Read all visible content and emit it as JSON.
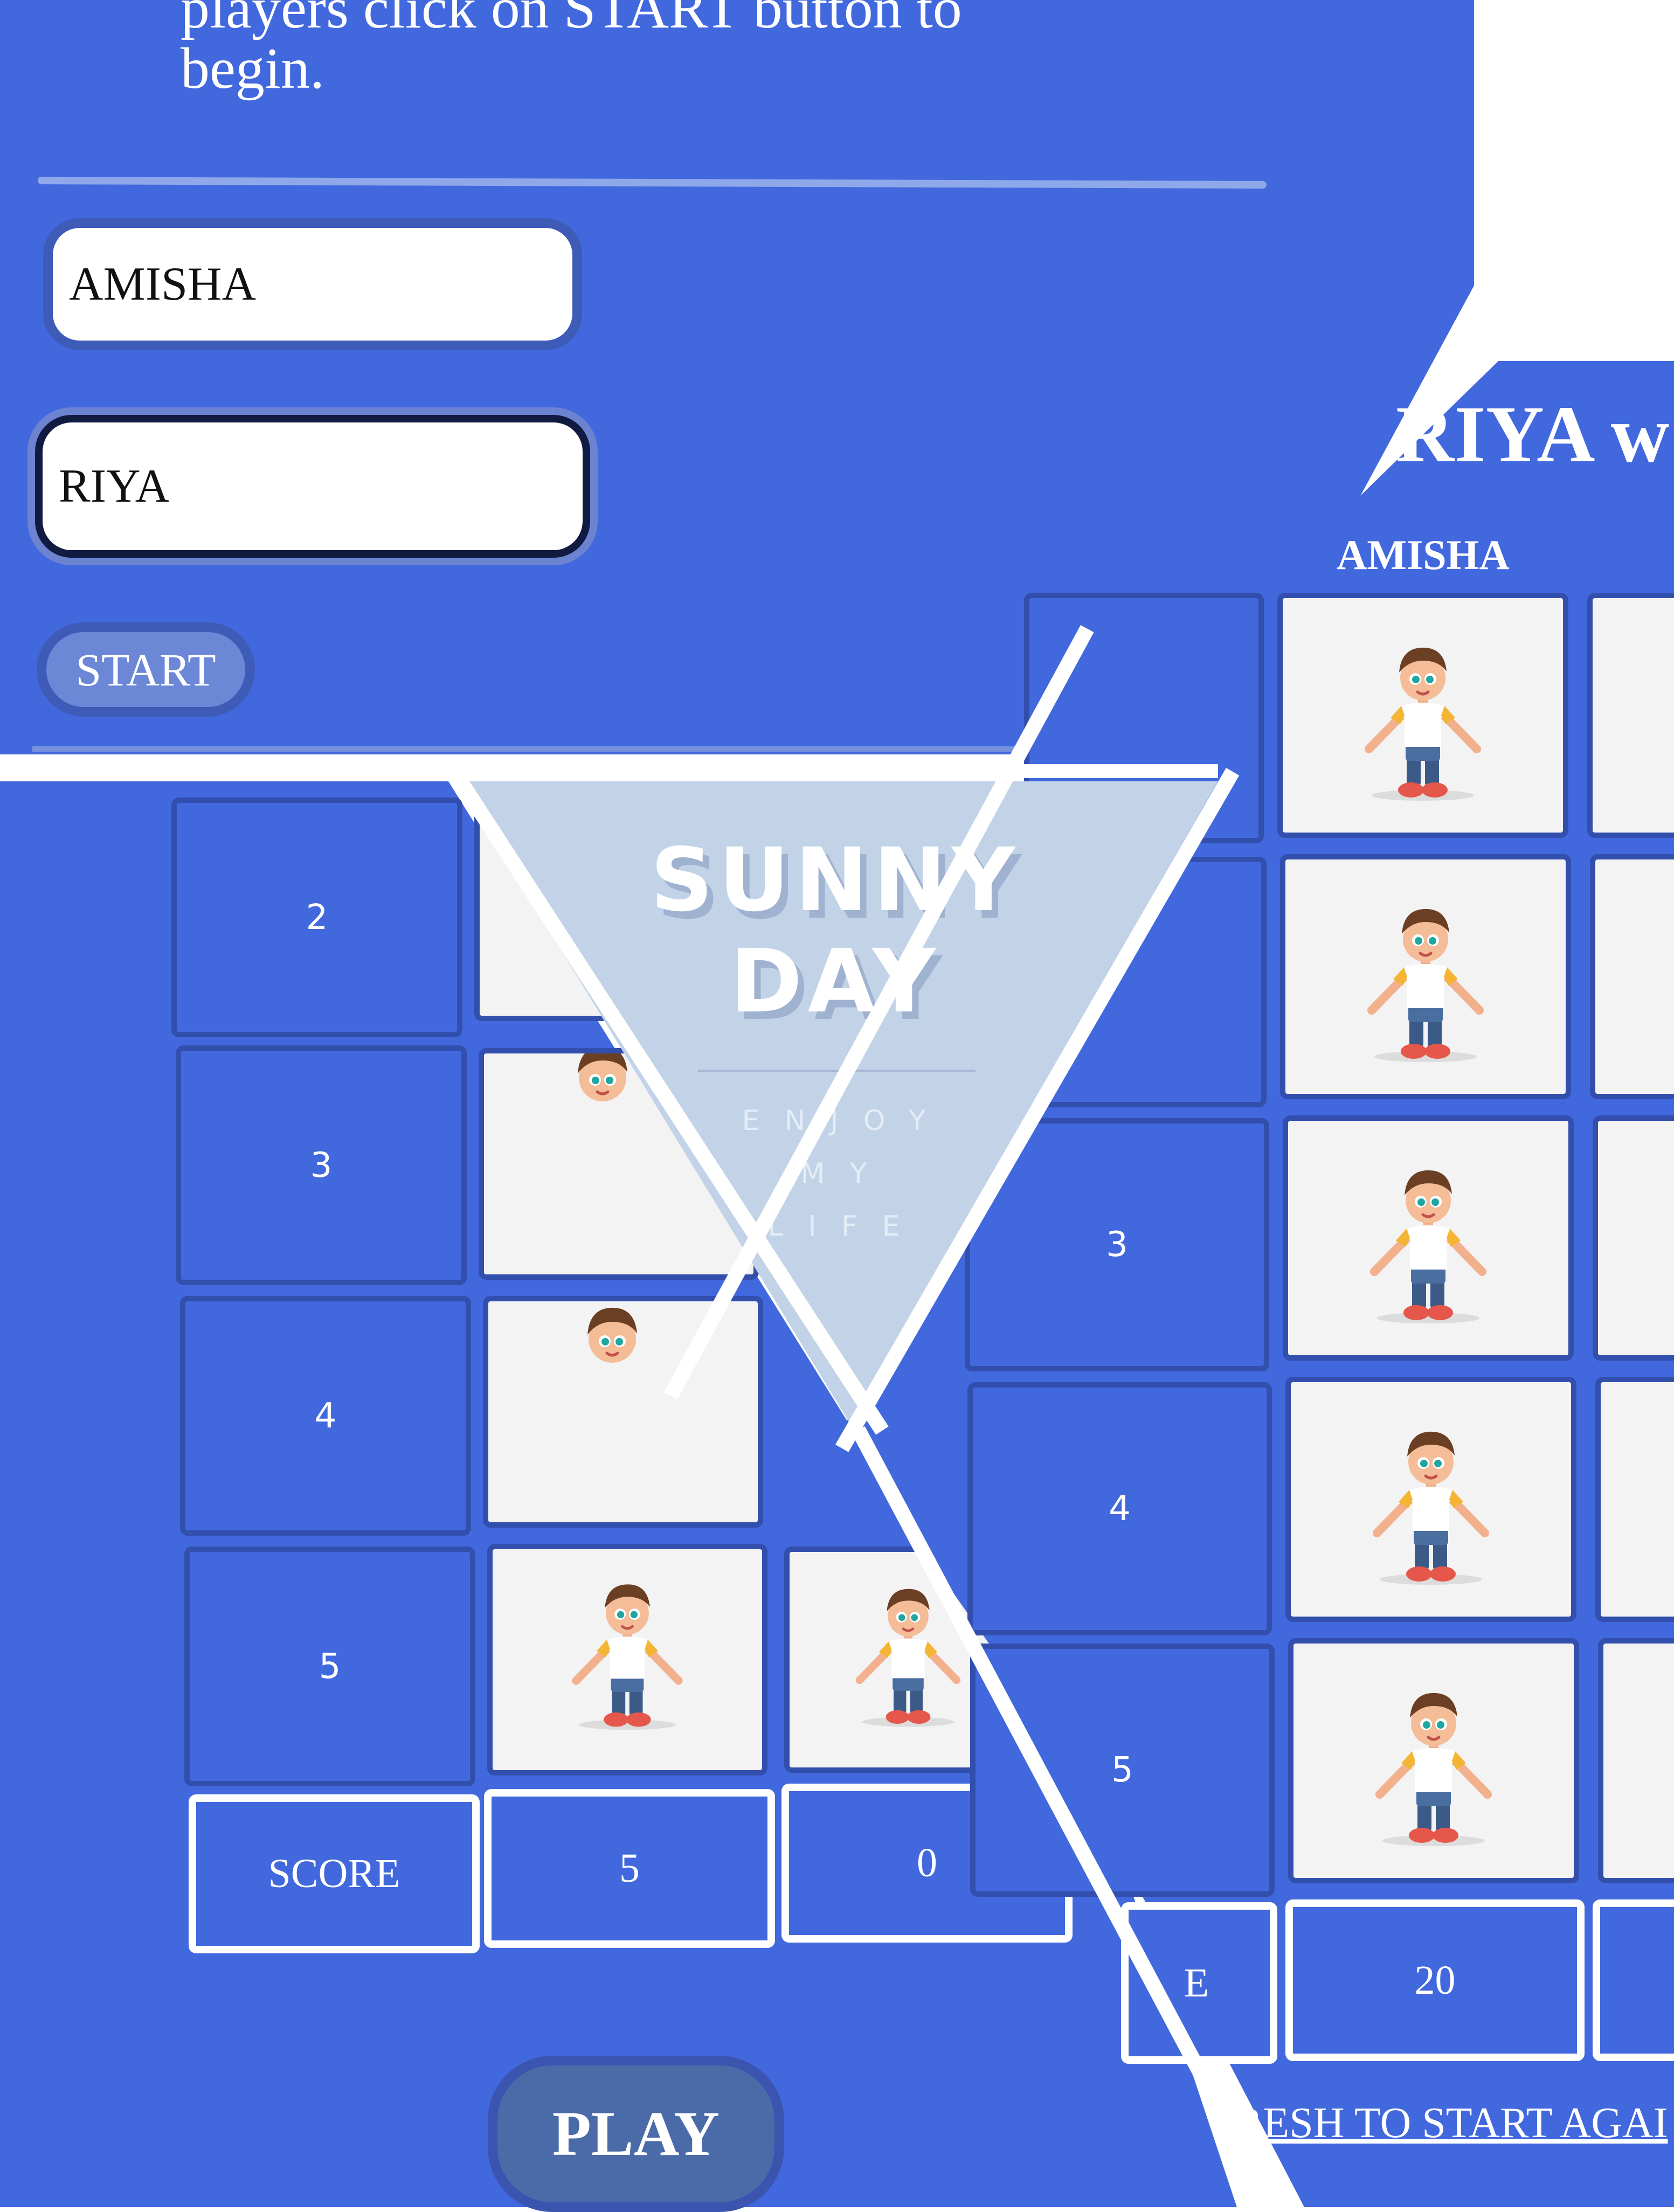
{
  "setup": {
    "intro_line1": "players click on START button to",
    "intro_line2": "begin.",
    "player1_value": "AMISHA",
    "player2_value": "RIYA",
    "start_label": "START"
  },
  "board_left": {
    "rows": [
      "2",
      "3",
      "4",
      "5"
    ],
    "score_label": "SCORE",
    "score_p1": "5",
    "score_p2": "0",
    "play_label": "PLAY"
  },
  "banner": {
    "title_line1": "SUNNY",
    "title_line2": "DAY",
    "sub1": "ENJOY",
    "sub2": "MY",
    "sub3": "LIFE"
  },
  "board_right": {
    "winner_text": "RIYA w",
    "player1_label": "AMISHA",
    "rows": [
      "2",
      "3",
      "4",
      "5"
    ],
    "score_label_fragment": "E",
    "score_p1": "20",
    "refresh_text": "RESH TO START AGAI"
  },
  "colors": {
    "background_blue": "#4268de",
    "banner_blue_grey": "#c2d3e8",
    "text_white": "#ffffff"
  },
  "icons": {
    "character": "cartoon-boy-character"
  }
}
